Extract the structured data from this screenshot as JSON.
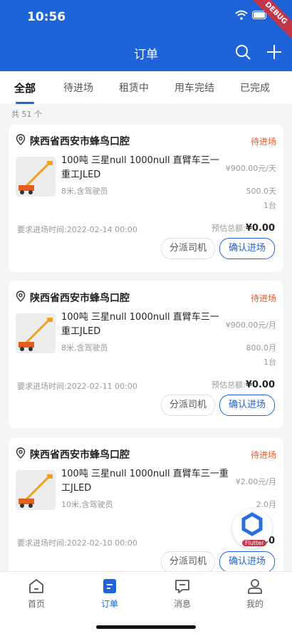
{
  "status_bar": {
    "time": "10:56",
    "debug_label": "DEBUG"
  },
  "header": {
    "title": "订单"
  },
  "tabs": [
    {
      "label": "全部"
    },
    {
      "label": "待进场"
    },
    {
      "label": "租赁中"
    },
    {
      "label": "用车完结"
    },
    {
      "label": "已完成"
    }
  ],
  "count_text": "共 51 个",
  "orders": [
    {
      "address": "陕西省西安市蜂鸟口腔",
      "status": "待进场",
      "product_name": "100吨 三星null 1000null 直臂车三一重工JLED",
      "product_desc": "8米,含驾驶员",
      "price": "¥900.00元/天",
      "duration": "500.0天",
      "quantity": "1台",
      "required_time": "要求进场时间:2022-02-14 00:00",
      "total_label": "预估总额:",
      "total_value": "¥0.00",
      "assign_label": "分派司机",
      "confirm_label": "确认进场"
    },
    {
      "address": "陕西省西安市蜂鸟口腔",
      "status": "待进场",
      "product_name": "100吨 三星null 1000null 直臂车三一重工JLED",
      "product_desc": "8米,含驾驶员",
      "price": "¥900.00元/月",
      "duration": "800.0月",
      "quantity": "1台",
      "required_time": "要求进场时间:2022-02-11 00:00",
      "total_label": "预估总额:",
      "total_value": "¥0.00",
      "assign_label": "分派司机",
      "confirm_label": "确认进场"
    },
    {
      "address": "陕西省西安市蜂鸟口腔",
      "status": "待进场",
      "product_name": "100吨 三星null 1000null 直臂车三一重工JLED",
      "product_desc": "10米,含驾驶员",
      "price": "¥2.00元/月",
      "duration": "2.0月",
      "quantity": "",
      "required_time": "要求进场时间:2022-02-10 00:00",
      "total_label": "",
      "total_value": ".00",
      "assign_label": "分派司机",
      "confirm_label": "确认进场"
    }
  ],
  "flutter_badge": "Flutter",
  "bottom_nav": [
    {
      "label": "首页",
      "icon": "home-icon"
    },
    {
      "label": "订单",
      "icon": "order-icon"
    },
    {
      "label": "消息",
      "icon": "message-icon"
    },
    {
      "label": "我的",
      "icon": "profile-icon"
    }
  ],
  "colors": {
    "primary": "#1e63d8",
    "status": "#f05a28",
    "debug": "#c2364b"
  }
}
